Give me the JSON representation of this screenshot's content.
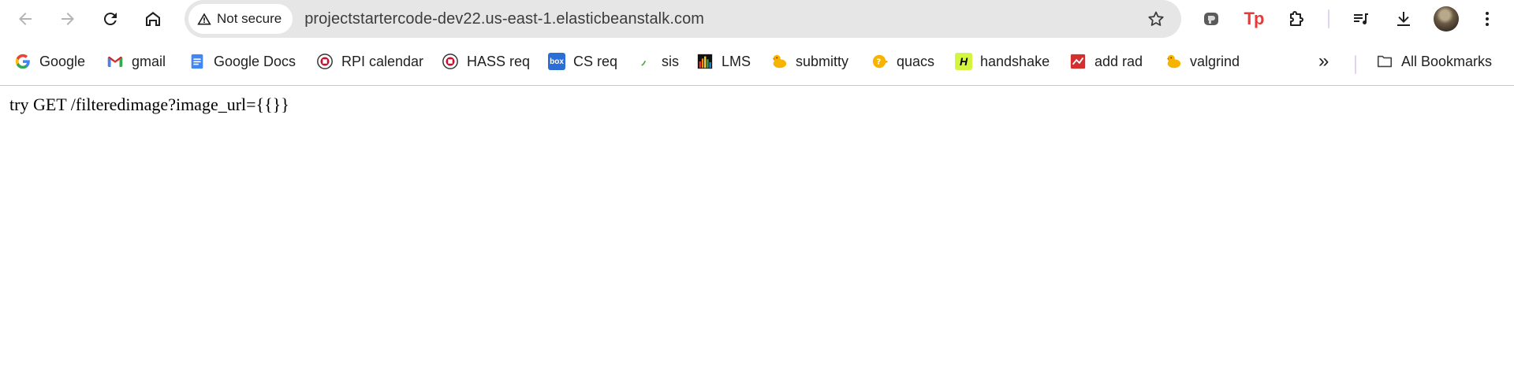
{
  "browser": {
    "security_label": "Not secure",
    "url": "projectstartercode-dev22.us-east-1.elasticbeanstalk.com",
    "icons": [
      "back-icon",
      "forward-icon",
      "reload-icon",
      "home-icon",
      "warning-icon",
      "star-icon",
      "puzzle-extension-icon",
      "reading-list-icon",
      "download-icon",
      "avatar",
      "more-vert-icon"
    ],
    "accent": "#1f1f1f"
  },
  "extensions": {
    "tp_label": "Tp"
  },
  "bookmarks": {
    "items": [
      {
        "label": "Google",
        "icon": "google-icon"
      },
      {
        "label": "gmail",
        "icon": "gmail-icon"
      },
      {
        "label": "Google Docs",
        "icon": "google-docs-icon"
      },
      {
        "label": "RPI calendar",
        "icon": "rpi-seal-icon"
      },
      {
        "label": "HASS req",
        "icon": "rpi-seal-icon"
      },
      {
        "label": "CS req",
        "icon": "box-icon"
      },
      {
        "label": "sis",
        "icon": "sis-icon"
      },
      {
        "label": "LMS",
        "icon": "lms-icon"
      },
      {
        "label": "submitty",
        "icon": "duck-icon"
      },
      {
        "label": "quacs",
        "icon": "quacs-icon"
      },
      {
        "label": "handshake",
        "icon": "handshake-icon"
      },
      {
        "label": "add rad",
        "icon": "add-rad-icon"
      },
      {
        "label": "valgrind",
        "icon": "duck-icon"
      }
    ],
    "box_glyph": "box",
    "handshake_glyph": "H",
    "overflow_label": "»",
    "all_bookmarks_label": "All Bookmarks"
  },
  "page": {
    "body_text": "try GET /filteredimage?image_url={{}}"
  }
}
